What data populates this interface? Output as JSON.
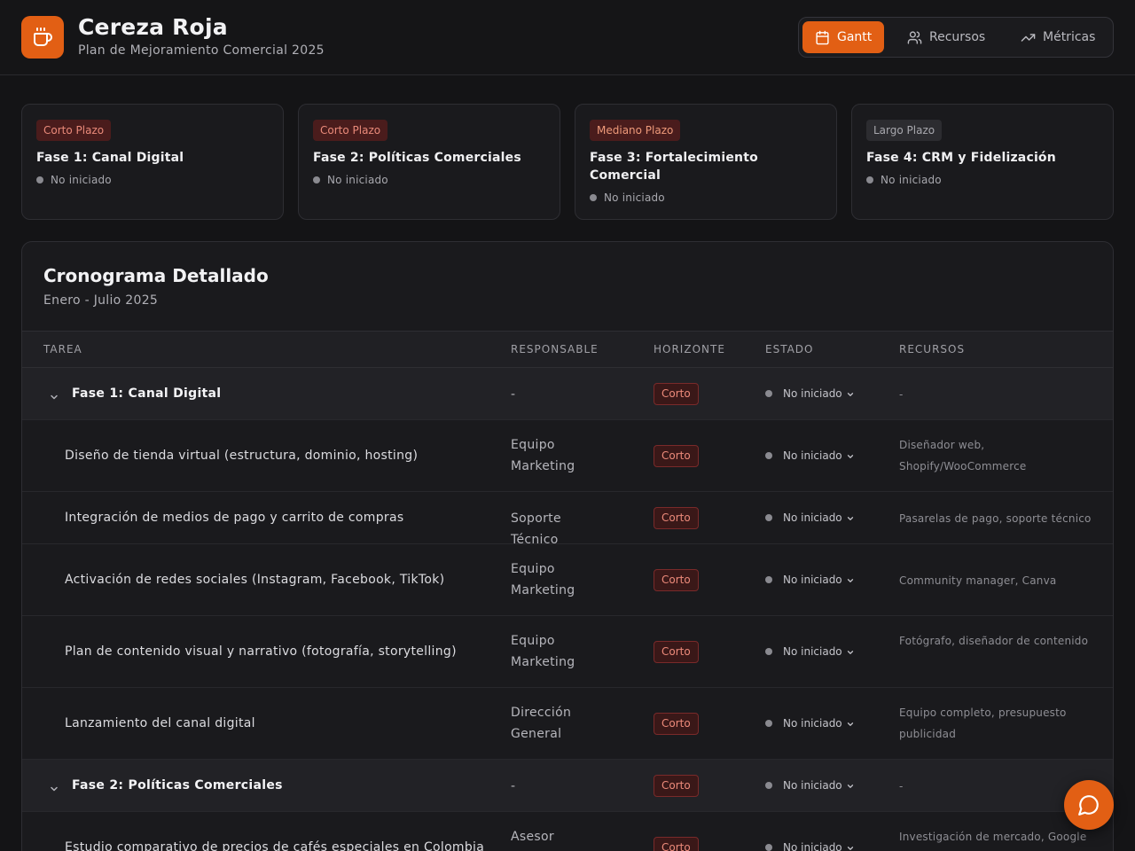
{
  "header": {
    "title": "Cereza Roja",
    "subtitle": "Plan de Mejoramiento Comercial 2025",
    "logo_icon": "coffee-cup-icon",
    "nav": [
      {
        "label": "Gantt",
        "icon": "calendar-icon",
        "active": true
      },
      {
        "label": "Recursos",
        "icon": "users-icon",
        "active": false
      },
      {
        "label": "Métricas",
        "icon": "trending-up-icon",
        "active": false
      }
    ]
  },
  "phases": [
    {
      "badge": "Corto Plazo",
      "title": "Fase 1: Canal Digital",
      "status": "No iniciado"
    },
    {
      "badge": "Corto Plazo",
      "title": "Fase 2: Políticas Comerciales",
      "status": "No iniciado"
    },
    {
      "badge": "Mediano Plazo",
      "title": "Fase 3: Fortalecimiento Comercial",
      "status": "No iniciado"
    },
    {
      "badge": "Largo Plazo",
      "title": "Fase 4: CRM y Fidelización",
      "status": "No iniciado"
    }
  ],
  "schedule": {
    "title": "Cronograma Detallado",
    "subtitle": "Enero - Julio 2025",
    "columns": [
      "TAREA",
      "RESPONSABLE",
      "HORIZONTE",
      "ESTADO",
      "RECURSOS"
    ],
    "rows": [
      {
        "type": "phase",
        "task": "Fase 1: Canal Digital",
        "responsable": "-",
        "horizonte": "Corto",
        "estado": "No iniciado",
        "recursos": "-"
      },
      {
        "type": "task",
        "task": "Diseño de tienda virtual (estructura, dominio, hosting)",
        "responsable": "Equipo Marketing",
        "horizonte": "Corto",
        "estado": "No iniciado",
        "recursos": "Diseñador web, Shopify/WooCommerce"
      },
      {
        "type": "task",
        "task": "Integración de medios de pago y carrito de compras",
        "responsable": "Soporte Técnico",
        "horizonte": "Corto",
        "estado": "No iniciado",
        "recursos": "Pasarelas de pago, soporte técnico"
      },
      {
        "type": "task",
        "task": "Activación de redes sociales (Instagram, Facebook, TikTok)",
        "responsable": "Equipo Marketing",
        "horizonte": "Corto",
        "estado": "No iniciado",
        "recursos": "Community manager, Canva"
      },
      {
        "type": "task",
        "task": "Plan de contenido visual y narrativo (fotografía, storytelling)",
        "responsable": "Equipo Marketing",
        "horizonte": "Corto",
        "estado": "No iniciado",
        "recursos": "Fotógrafo, diseñador de contenido"
      },
      {
        "type": "task",
        "task": "Lanzamiento del canal digital",
        "responsable": "Dirección General",
        "horizonte": "Corto",
        "estado": "No iniciado",
        "recursos": "Equipo completo, presupuesto publicidad"
      },
      {
        "type": "phase",
        "task": "Fase 2: Políticas Comerciales",
        "responsable": "-",
        "horizonte": "Corto",
        "estado": "No iniciado",
        "recursos": "-"
      },
      {
        "type": "task",
        "task": "Estudio comparativo de precios de cafés especiales en Colombia",
        "responsable": "Asesor",
        "horizonte": "Corto",
        "estado": "No iniciado",
        "recursos": "Investigación de mercado, Google"
      }
    ]
  }
}
